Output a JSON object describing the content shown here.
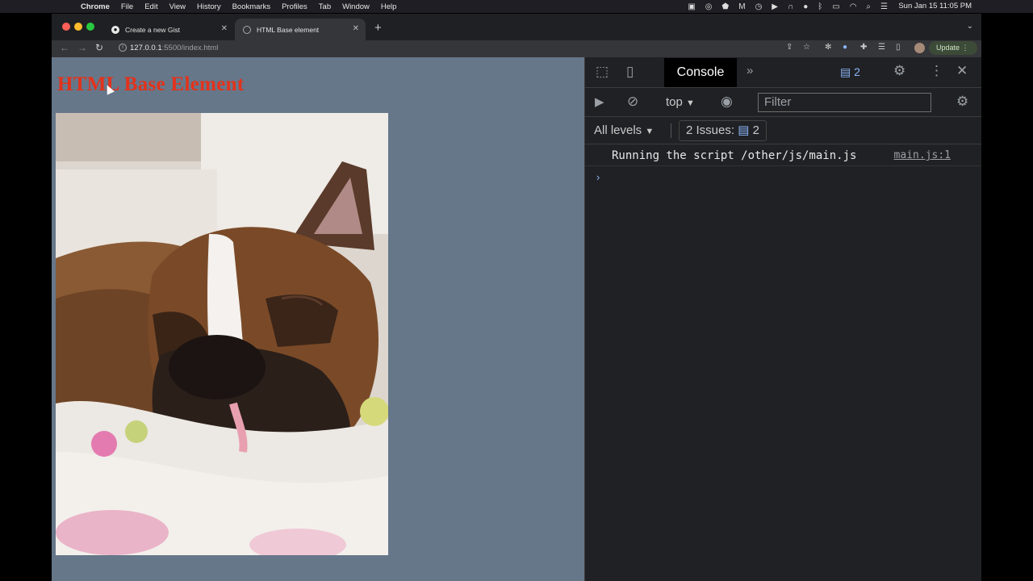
{
  "menubar": {
    "app": "Chrome",
    "items": [
      "File",
      "Edit",
      "View",
      "History",
      "Bookmarks",
      "Profiles",
      "Tab",
      "Window",
      "Help"
    ],
    "clock": "Sun Jan 15  11:05 PM"
  },
  "tabs": [
    {
      "title": "Create a new Gist",
      "favicon": "github-icon"
    },
    {
      "title": "HTML Base element",
      "favicon": "globe-icon"
    }
  ],
  "toolbar": {
    "url_host": "127.0.0.1",
    "url_rest": ":5500/index.html",
    "update_label": "Update"
  },
  "page": {
    "heading": "HTML Base Element",
    "image_alt": "boxer dog sleeping on a blanket"
  },
  "devtools": {
    "tab_console": "Console",
    "issue_badge_count": "2",
    "context": "top",
    "filter_placeholder": "Filter",
    "levels": "All levels",
    "issues_label": "2 Issues:",
    "issues_count": "2",
    "log": [
      {
        "message": "Running the script /other/js/main.js",
        "source": "main.js:1"
      }
    ]
  },
  "colors": {
    "heading": "#e3321b",
    "page_bg": "#66778a",
    "devtools_bg": "#202124"
  }
}
